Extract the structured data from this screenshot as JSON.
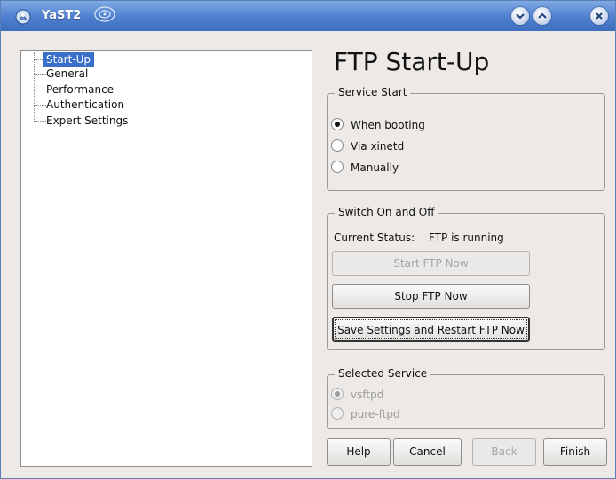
{
  "window": {
    "title": "YaST2",
    "icons": {
      "app": "yast-icon",
      "deco": "gecko-icon",
      "minimize": "chevron-down-icon",
      "maximize": "chevron-up-icon",
      "close": "close-icon"
    }
  },
  "tree": {
    "items": [
      {
        "label": "Start-Up",
        "selected": true
      },
      {
        "label": "General",
        "selected": false
      },
      {
        "label": "Performance",
        "selected": false
      },
      {
        "label": "Authentication",
        "selected": false
      },
      {
        "label": "Expert Settings",
        "selected": false
      }
    ]
  },
  "page": {
    "heading": "FTP Start-Up"
  },
  "service_start": {
    "title": "Service Start",
    "options": [
      {
        "label": "When booting",
        "checked": true
      },
      {
        "label": "Via xinetd",
        "checked": false
      },
      {
        "label": "Manually",
        "checked": false
      }
    ]
  },
  "switch": {
    "title": "Switch On and Off",
    "status_label": "Current Status:",
    "status_value": "FTP is running",
    "start_button": "Start FTP Now",
    "stop_button": "Stop FTP Now",
    "save_restart_button": "Save Settings and Restart FTP Now"
  },
  "selected_service": {
    "title": "Selected Service",
    "options": [
      {
        "label": "vsftpd",
        "checked": true
      },
      {
        "label": "pure-ftpd",
        "checked": false
      }
    ]
  },
  "buttons": {
    "help": "Help",
    "cancel": "Cancel",
    "back": "Back",
    "finish": "Finish"
  }
}
